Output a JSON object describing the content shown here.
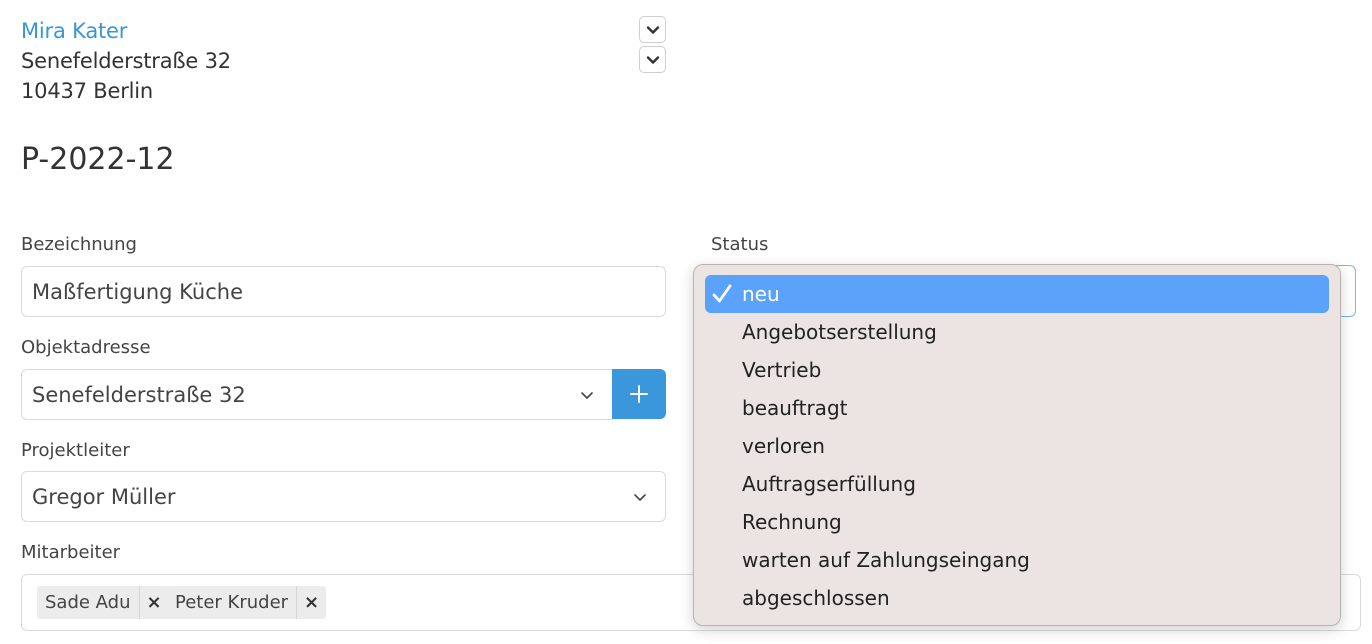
{
  "contact": {
    "name": "Mira Kater",
    "street": "Senefelderstraße 32",
    "city": "10437 Berlin"
  },
  "project": {
    "number": "P-2022-12"
  },
  "form": {
    "bezeichnung": {
      "label": "Bezeichnung",
      "value": "Maßfertigung Küche"
    },
    "objektadresse": {
      "label": "Objektadresse",
      "value": "Senefelderstraße 32"
    },
    "projektleiter": {
      "label": "Projektleiter",
      "value": "Gregor Müller"
    },
    "mitarbeiter": {
      "label": "Mitarbeiter",
      "tags": [
        "Sade Adu",
        "Peter Kruder"
      ],
      "remove_symbol": "×"
    },
    "status": {
      "label": "Status",
      "selected": "neu",
      "options": [
        "neu",
        "Angebotserstellung",
        "Vertrieb",
        "beauftragt",
        "verloren",
        "Auftragserfüllung",
        "Rechnung",
        "warten auf Zahlungseingang",
        "abgeschlossen"
      ]
    }
  },
  "icons": {
    "chevron": "chevron-down-icon",
    "plus": "plus-icon",
    "check": "checkmark-icon",
    "remove": "close-icon"
  },
  "colors": {
    "link": "#3a97d4",
    "accent_button": "#3a97dc",
    "selected_option": "#5ba2fb",
    "dropdown_bg": "#ece4e2"
  }
}
